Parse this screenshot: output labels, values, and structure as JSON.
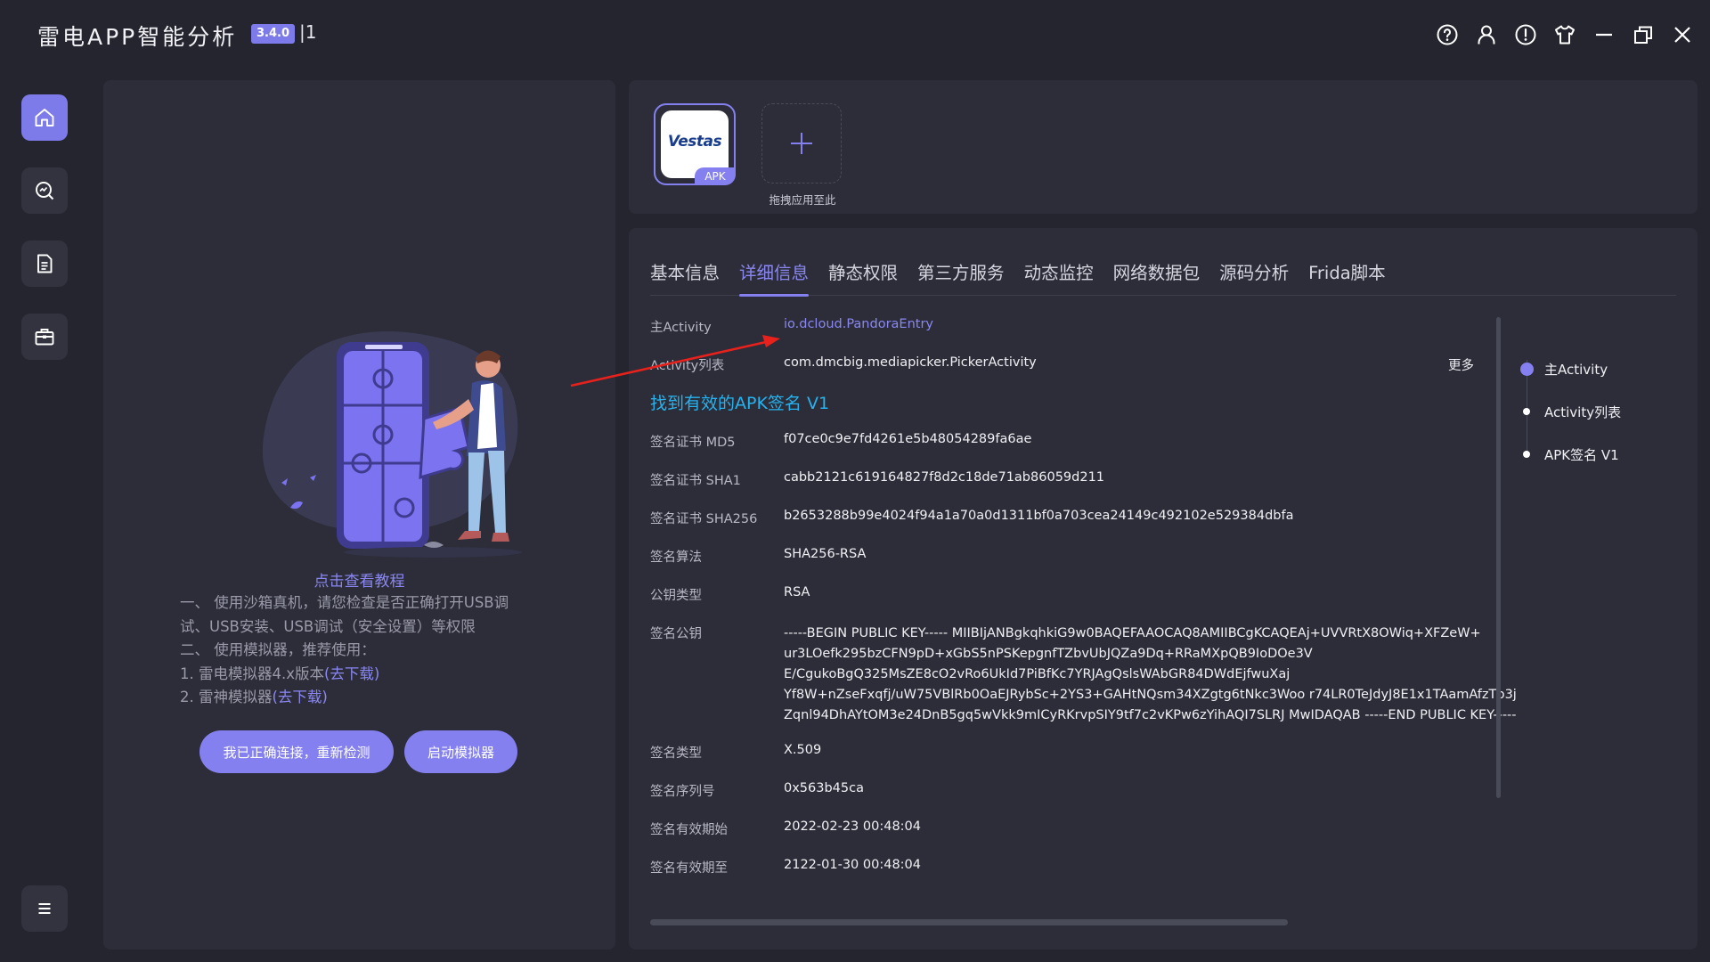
{
  "app": {
    "title": "雷电APP智能分析",
    "version": "3.4.0",
    "build": "|1",
    "accent": "#7d7bea"
  },
  "window_controls": [
    {
      "name": "help-icon"
    },
    {
      "name": "user-icon"
    },
    {
      "name": "alert-icon"
    },
    {
      "name": "skin-icon"
    },
    {
      "name": "minimize-icon"
    },
    {
      "name": "restore-icon"
    },
    {
      "name": "close-icon"
    }
  ],
  "sidebar": {
    "items": [
      {
        "name": "home-icon",
        "active": true
      },
      {
        "name": "analysis-icon",
        "active": false
      },
      {
        "name": "report-icon",
        "active": false
      },
      {
        "name": "toolbox-icon",
        "active": false
      }
    ],
    "menu_icon": "menu-icon"
  },
  "left_panel": {
    "tutorial_link": "点击查看教程",
    "line1": "一、 使用沙箱真机，请您检查是否正确打开USB调",
    "line2": "试、USB安装、USB调试（安全设置）等权限",
    "line3": "二、 使用模拟器，推荐使用：",
    "line4_prefix": "1. 雷电模拟器4.x版本",
    "line5_prefix": "2. 雷神模拟器",
    "download_label": "(去下载)",
    "recheck_button": "我已正确连接，重新检测",
    "emulator_button": "启动模拟器"
  },
  "apps": {
    "app_logo_text": "Vestas",
    "apk_tag": "APK",
    "drop_label": "拖拽应用至此"
  },
  "tabs": [
    {
      "label": "基本信息",
      "active": false
    },
    {
      "label": "详细信息",
      "active": true
    },
    {
      "label": "静态权限",
      "active": false
    },
    {
      "label": "第三方服务",
      "active": false
    },
    {
      "label": "动态监控",
      "active": false
    },
    {
      "label": "网络数据包",
      "active": false
    },
    {
      "label": "源码分析",
      "active": false
    },
    {
      "label": "Frida脚本",
      "active": false
    }
  ],
  "detail": {
    "main_activity_label": "主Activity",
    "main_activity_value": "io.dcloud.PandoraEntry",
    "activity_list_label": "Activity列表",
    "activity_list_value": "com.dmcbig.mediapicker.PickerActivity",
    "more_label": "更多",
    "signature_heading": "找到有效的APK签名 V1",
    "md5_label": "签名证书 MD5",
    "md5_value": "f07ce0c9e7fd4261e5b48054289fa6ae",
    "sha1_label": "签名证书 SHA1",
    "sha1_value": "cabb2121c619164827f8d2c18de71ab86059d211",
    "sha256_label": "签名证书 SHA256",
    "sha256_value": "b2653288b99e4024f94a1a70a0d1311bf0a703cea24149c492102e529384dbfa",
    "algorithm_label": "签名算法",
    "algorithm_value": "SHA256-RSA",
    "pubkey_type_label": "公钥类型",
    "pubkey_type_value": "RSA",
    "pubkey_label": "签名公钥",
    "pubkey_lines": [
      "-----BEGIN PUBLIC KEY----- MIIBIjANBgkqhkiG9w0BAQEFAAOCAQ8AMIIBCgKCAQEAj+UVVRtX8OWiq+XFZeW+",
      "ur3LOefk295bzCFN9pD+xGbS5nPSKepgnfTZbvUbJQZa9Dq+RRaMXpQB9IoDOe3V",
      "E/CgukoBgQ325MsZE8cO2vRo6UkId7PiBfKc7YRJAgQslsWAbGR84DWdEjfwuXaj",
      "Yf8W+nZseFxqfj/uW75VBlRb0OaEJRybSc+2YS3+GAHtNQsm34XZgtg6tNkc3Woo r74LR0TeJdyJ8E1x1TAamAfzTp3j",
      "Zqnl94DhAYtOM3e24DnB5gq5wVkk9mICyRKrvpSIY9tf7c2vKPw6zYihAQI7SLRJ MwIDAQAB -----END PUBLIC KEY-----"
    ],
    "cert_type_label": "签名类型",
    "cert_type_value": "X.509",
    "serial_label": "签名序列号",
    "serial_value": "0x563b45ca",
    "valid_from_label": "签名有效期始",
    "valid_from_value": "2022-02-23 00:48:04",
    "valid_to_label": "签名有效期至",
    "valid_to_value": "2122-01-30 00:48:04"
  },
  "toc": [
    {
      "label": "主Activity",
      "active": true
    },
    {
      "label": "Activity列表",
      "active": false
    },
    {
      "label": "APK签名 V1",
      "active": false
    }
  ]
}
